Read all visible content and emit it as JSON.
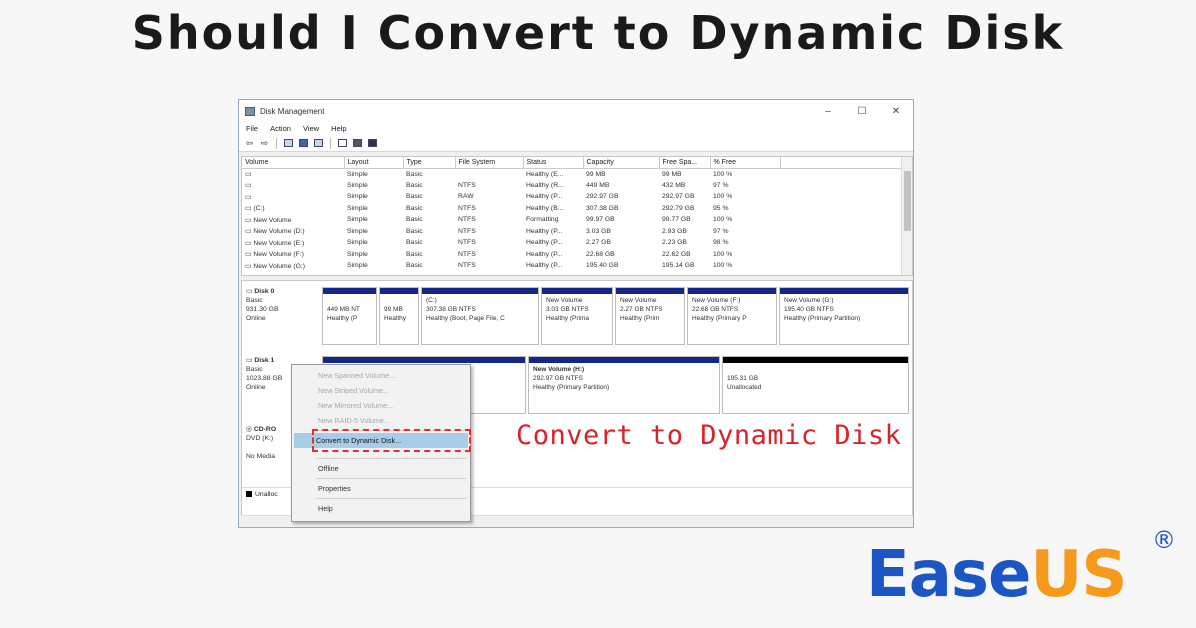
{
  "headline": "Should I Convert to Dynamic Disk",
  "window": {
    "title": "Disk Management",
    "controls": {
      "minimize": "–",
      "maximize": "☐",
      "close": "✕"
    },
    "menu": [
      "File",
      "Action",
      "View",
      "Help"
    ]
  },
  "volume_list": {
    "columns": [
      "Volume",
      "Layout",
      "Type",
      "File System",
      "Status",
      "Capacity",
      "Free Spa...",
      "% Free"
    ],
    "rows": [
      [
        "",
        "Simple",
        "Basic",
        "",
        "Healthy (E...",
        "99 MB",
        "99 MB",
        "100 %"
      ],
      [
        "",
        "Simple",
        "Basic",
        "NTFS",
        "Healthy (R...",
        "449 MB",
        "432 MB",
        "97 %"
      ],
      [
        "",
        "Simple",
        "Basic",
        "RAW",
        "Healthy (P...",
        "292.97 GB",
        "292.97 GB",
        "100 %"
      ],
      [
        "(C:)",
        "Simple",
        "Basic",
        "NTFS",
        "Healthy (B...",
        "307.38 GB",
        "292.79 GB",
        "95 %"
      ],
      [
        "New Volume",
        "Simple",
        "Basic",
        "NTFS",
        "Formatting",
        "99.97 GB",
        "99.77 GB",
        "100 %"
      ],
      [
        "New Volume (D:)",
        "Simple",
        "Basic",
        "NTFS",
        "Healthy (P...",
        "3.03 GB",
        "2.93 GB",
        "97 %"
      ],
      [
        "New Volume (E:)",
        "Simple",
        "Basic",
        "NTFS",
        "Healthy (P...",
        "2.27 GB",
        "2.23 GB",
        "98 %"
      ],
      [
        "New Volume (F:)",
        "Simple",
        "Basic",
        "NTFS",
        "Healthy (P...",
        "22.68 GB",
        "22.62 GB",
        "100 %"
      ],
      [
        "New Volume (G:)",
        "Simple",
        "Basic",
        "NTFS",
        "Healthy (P...",
        "195.40 GB",
        "195.14 GB",
        "100 %"
      ]
    ]
  },
  "disk0": {
    "name": "Disk 0",
    "type": "Basic",
    "size": "931.30 GB",
    "state": "Online",
    "partitions": [
      {
        "name": "",
        "size": "449 MB NT",
        "status": "Healthy (P"
      },
      {
        "name": "",
        "size": "99 MB",
        "status": "Healthy"
      },
      {
        "name": "(C:)",
        "size": "307.38 GB NTFS",
        "status": "Healthy (Boot, Page File, C"
      },
      {
        "name": "New Volume",
        "size": "3.03 GB NTFS",
        "status": "Healthy (Prima"
      },
      {
        "name": "New Volume",
        "size": "2.27 GB NTFS",
        "status": "Healthy (Prim"
      },
      {
        "name": "New Volume (F:)",
        "size": "22.68 GB NTFS",
        "status": "Healthy (Primary P"
      },
      {
        "name": "New Volume (G:)",
        "size": "195.40 GB NTFS",
        "status": "Healthy (Primary Partition)"
      }
    ]
  },
  "disk1": {
    "name": "Disk 1",
    "type": "Basic",
    "size": "1023.88 GB",
    "state": "Online",
    "partitions": [
      {
        "name": "New Volume (H:)",
        "size": "292.97 GB NTFS",
        "status": "Healthy (Primary Partition)"
      },
      {
        "name": "",
        "size": "195.31 GB",
        "status": "Unallocated"
      }
    ]
  },
  "cdrom": {
    "name": "CD-RO",
    "type": "DVD (K:)",
    "state": "No Media"
  },
  "legend": {
    "unallocated": "Unalloc"
  },
  "context_menu": {
    "items": [
      {
        "label": "New Spanned Volume...",
        "disabled": true
      },
      {
        "label": "New Striped Volume...",
        "disabled": true
      },
      {
        "label": "New Mirrored Volume...",
        "disabled": true
      },
      {
        "label": "New RAID-5 Volume...",
        "disabled": true
      },
      {
        "label": "Convert to Dynamic Disk...",
        "disabled": false,
        "highlighted": true
      },
      {
        "label": "Offline",
        "disabled": false
      },
      {
        "label": "Properties",
        "disabled": false
      },
      {
        "label": "Help",
        "disabled": false
      }
    ]
  },
  "annotation": "Convert to Dynamic Disk",
  "logo": {
    "left": "Ease",
    "right": "US",
    "mark": "®"
  },
  "colors": {
    "partition_bar": "#15268a",
    "highlight": "#a8cde9",
    "annotation": "#d8232a",
    "logo_blue": "#1b56c4",
    "logo_orange": "#f59a1a"
  }
}
